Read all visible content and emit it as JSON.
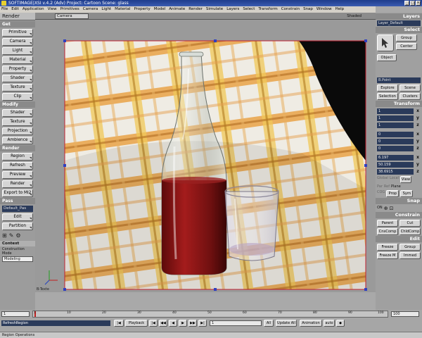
{
  "window": {
    "title": "SOFTIMAGE|XSI v.4.2 (Adv) Project: Cartoon   Scene: glass",
    "controls": [
      "_",
      "□",
      "×"
    ]
  },
  "menu": [
    "File",
    "Edit",
    "Application",
    "View",
    "Primitives",
    "Camera",
    "Light",
    "Material",
    "Property",
    "Model",
    "Animate",
    "Render",
    "Simulate",
    "Layers",
    "Select",
    "Transform",
    "Constrain",
    "Snap",
    "Window",
    "Help"
  ],
  "left_panel": {
    "mode": "Render",
    "get": {
      "title": "Get",
      "buttons": [
        "Primitive",
        "Camera",
        "Light",
        "Material",
        "Property",
        "Shader",
        "Texture",
        "Clip"
      ]
    },
    "modify": {
      "title": "Modify",
      "buttons": [
        "Shader",
        "Texture",
        "Projection",
        "Ambience"
      ]
    },
    "render": {
      "title": "Render",
      "buttons": [
        "Region",
        "Refresh",
        "Preview",
        "Render",
        "Export to MI2"
      ]
    },
    "pass": {
      "title": "Pass",
      "field": "Default_Pas",
      "buttons": [
        "Edit",
        "Partition"
      ]
    },
    "context": {
      "title": "Context",
      "label": "Construction Mode",
      "value": "Modeling"
    }
  },
  "viewport": {
    "camera": "Camera",
    "shading": "Shaded",
    "label": "B-Texte",
    "colors": {
      "cloth_light": "#f2f0ea",
      "cloth_orange": "#e8a04a",
      "cloth_yellow": "#f0d060",
      "liquid": "#7a1010",
      "background": "#0a0a0a"
    }
  },
  "right_panel": {
    "layers": {
      "title": "Layers",
      "field": "Layer_Default"
    },
    "select": {
      "title": "Select",
      "buttons": [
        "Group",
        "Center",
        "Object"
      ],
      "field": "B.Point",
      "row1": [
        "Explore",
        "Scene"
      ],
      "row2": [
        "Selection",
        "Clusters"
      ]
    },
    "transform": {
      "title": "Transform",
      "scale": [
        {
          "v": "1",
          "a": "x"
        },
        {
          "v": "1",
          "a": "y"
        },
        {
          "v": "1",
          "a": "z"
        }
      ],
      "rotate": [
        {
          "v": "0",
          "a": "x"
        },
        {
          "v": "0",
          "a": "y"
        },
        {
          "v": "0",
          "a": "z"
        }
      ],
      "translate": [
        {
          "v": "6.197",
          "a": "x"
        },
        {
          "v": "50.159",
          "a": "y"
        },
        {
          "v": "38.6915",
          "a": "z"
        }
      ],
      "modes": [
        "Global",
        "Local",
        "View"
      ],
      "modes2": [
        "Par",
        "Ref",
        "Plane"
      ],
      "bottom": [
        "COG",
        "Prop",
        "Sym"
      ]
    },
    "snap": {
      "title": "Snap",
      "on_label": "ON"
    },
    "constrain": {
      "title": "Constrain",
      "row1": [
        "Parent",
        "Cut"
      ],
      "row2": [
        "CnsComp",
        "ChldComp"
      ]
    },
    "edit": {
      "title": "Edit",
      "row1": [
        "Freeze",
        "Group"
      ],
      "row2": [
        "Freeze M",
        "Immed"
      ]
    }
  },
  "bottom_bar": {
    "frame_start": "1",
    "frame_end": "100",
    "ticks": [
      "1",
      "10",
      "20",
      "30",
      "40",
      "50",
      "60",
      "70",
      "80",
      "90",
      "100"
    ],
    "command": "RefreshRegion",
    "playback": "Playback",
    "current_frame": "1",
    "all": "All",
    "update_all": "Update All",
    "animation": "Animation",
    "auto": "auto",
    "status": "Region Operations"
  }
}
